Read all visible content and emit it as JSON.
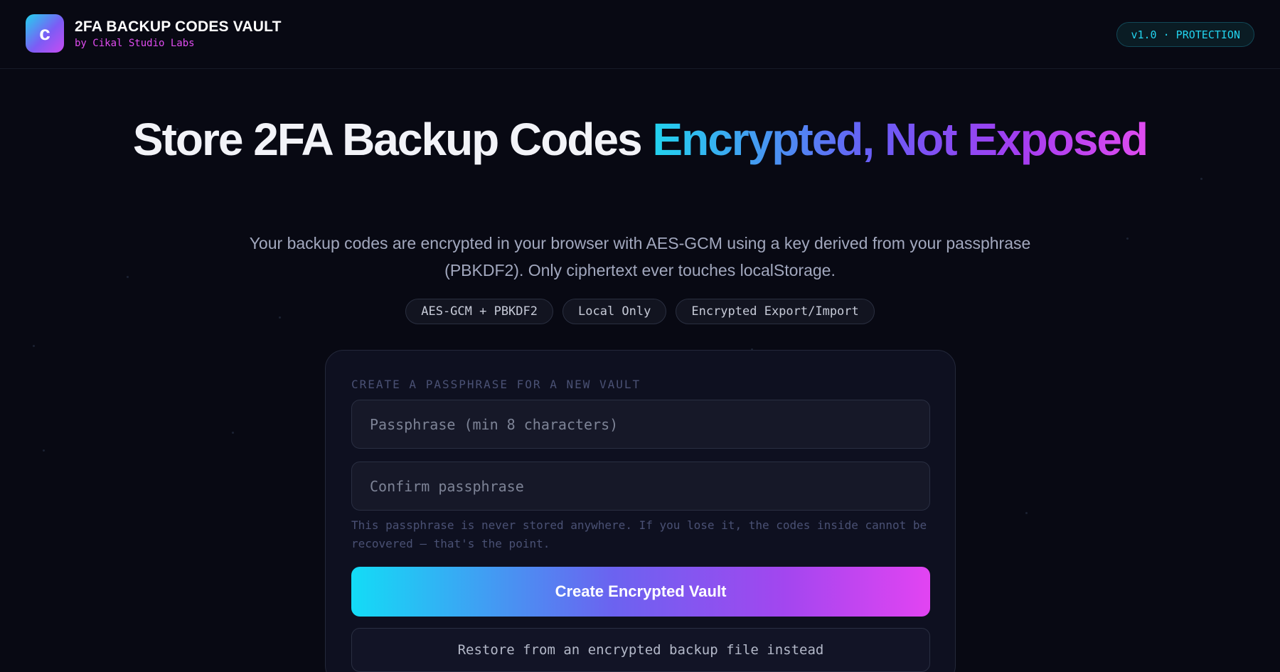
{
  "header": {
    "logo_letter": "c",
    "title": "2FA BACKUP CODES VAULT",
    "subtitle": "by Cikal Studio Labs",
    "version_badge": "v1.0 · PROTECTION"
  },
  "hero": {
    "title_plain": "Store 2FA Backup Codes ",
    "title_highlight": "Encrypted, Not Exposed",
    "description": "Your backup codes are encrypted in your browser with AES-GCM using a key derived from your passphrase (PBKDF2). Only ciphertext ever touches localStorage.",
    "chips": [
      "AES-GCM + PBKDF2",
      "Local Only",
      "Encrypted Export/Import"
    ]
  },
  "vault_form": {
    "section_label": "CREATE A PASSPHRASE FOR A NEW VAULT",
    "passphrase": {
      "value": "",
      "placeholder": "Passphrase (min 8 characters)"
    },
    "confirm": {
      "value": "",
      "placeholder": "Confirm passphrase"
    },
    "hint": "This passphrase is never stored anywhere. If you lose it, the codes inside cannot be recovered — that's the point.",
    "create_button": "Create Encrypted Vault",
    "restore_button": "Restore from an encrypted backup file instead"
  },
  "colors": {
    "background": "#080913",
    "accent_cyan": "#22d3ee",
    "accent_violet": "#7c5cf5",
    "accent_magenta": "#e04cf0"
  }
}
